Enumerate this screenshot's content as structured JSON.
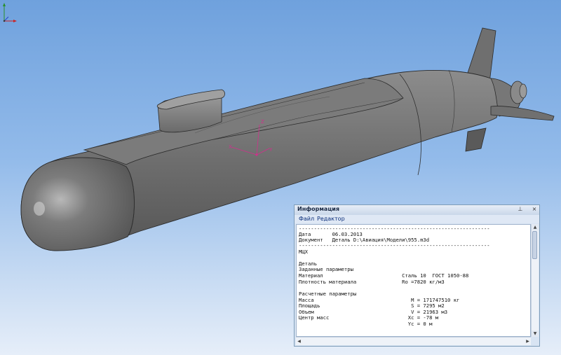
{
  "viewport": {
    "model_name": "submarine-model",
    "lcs_labels": {
      "z": "Z",
      "x": "X",
      "y": "Y"
    }
  },
  "info_panel": {
    "title": "Информация",
    "pin_glyph": "⊥",
    "min_glyph": "▫",
    "close_glyph": "×",
    "menu": [
      "Файл",
      "Редактор"
    ],
    "lines": [
      "---------------------------------------------------------------",
      "Дата       06.03.2013",
      "Документ   Деталь D:\\Авиация\\Модели\\955.m3d",
      "---------------------------------------------------------------",
      "МЦХ",
      "",
      "Деталь",
      "Заданные параметры",
      "Материал                          Сталь 10  ГОСТ 1050-88",
      "Плотность материала               Ro =7820 кг/м3",
      "",
      "Расчетные параметры",
      "Масса                                M = 171747510 кг",
      "Площадь                              S = 7295 м2",
      "Объем                                V = 21963 м3",
      "Центр масс                          Xc = -78 м",
      "                                    Yc = 0 м"
    ]
  }
}
